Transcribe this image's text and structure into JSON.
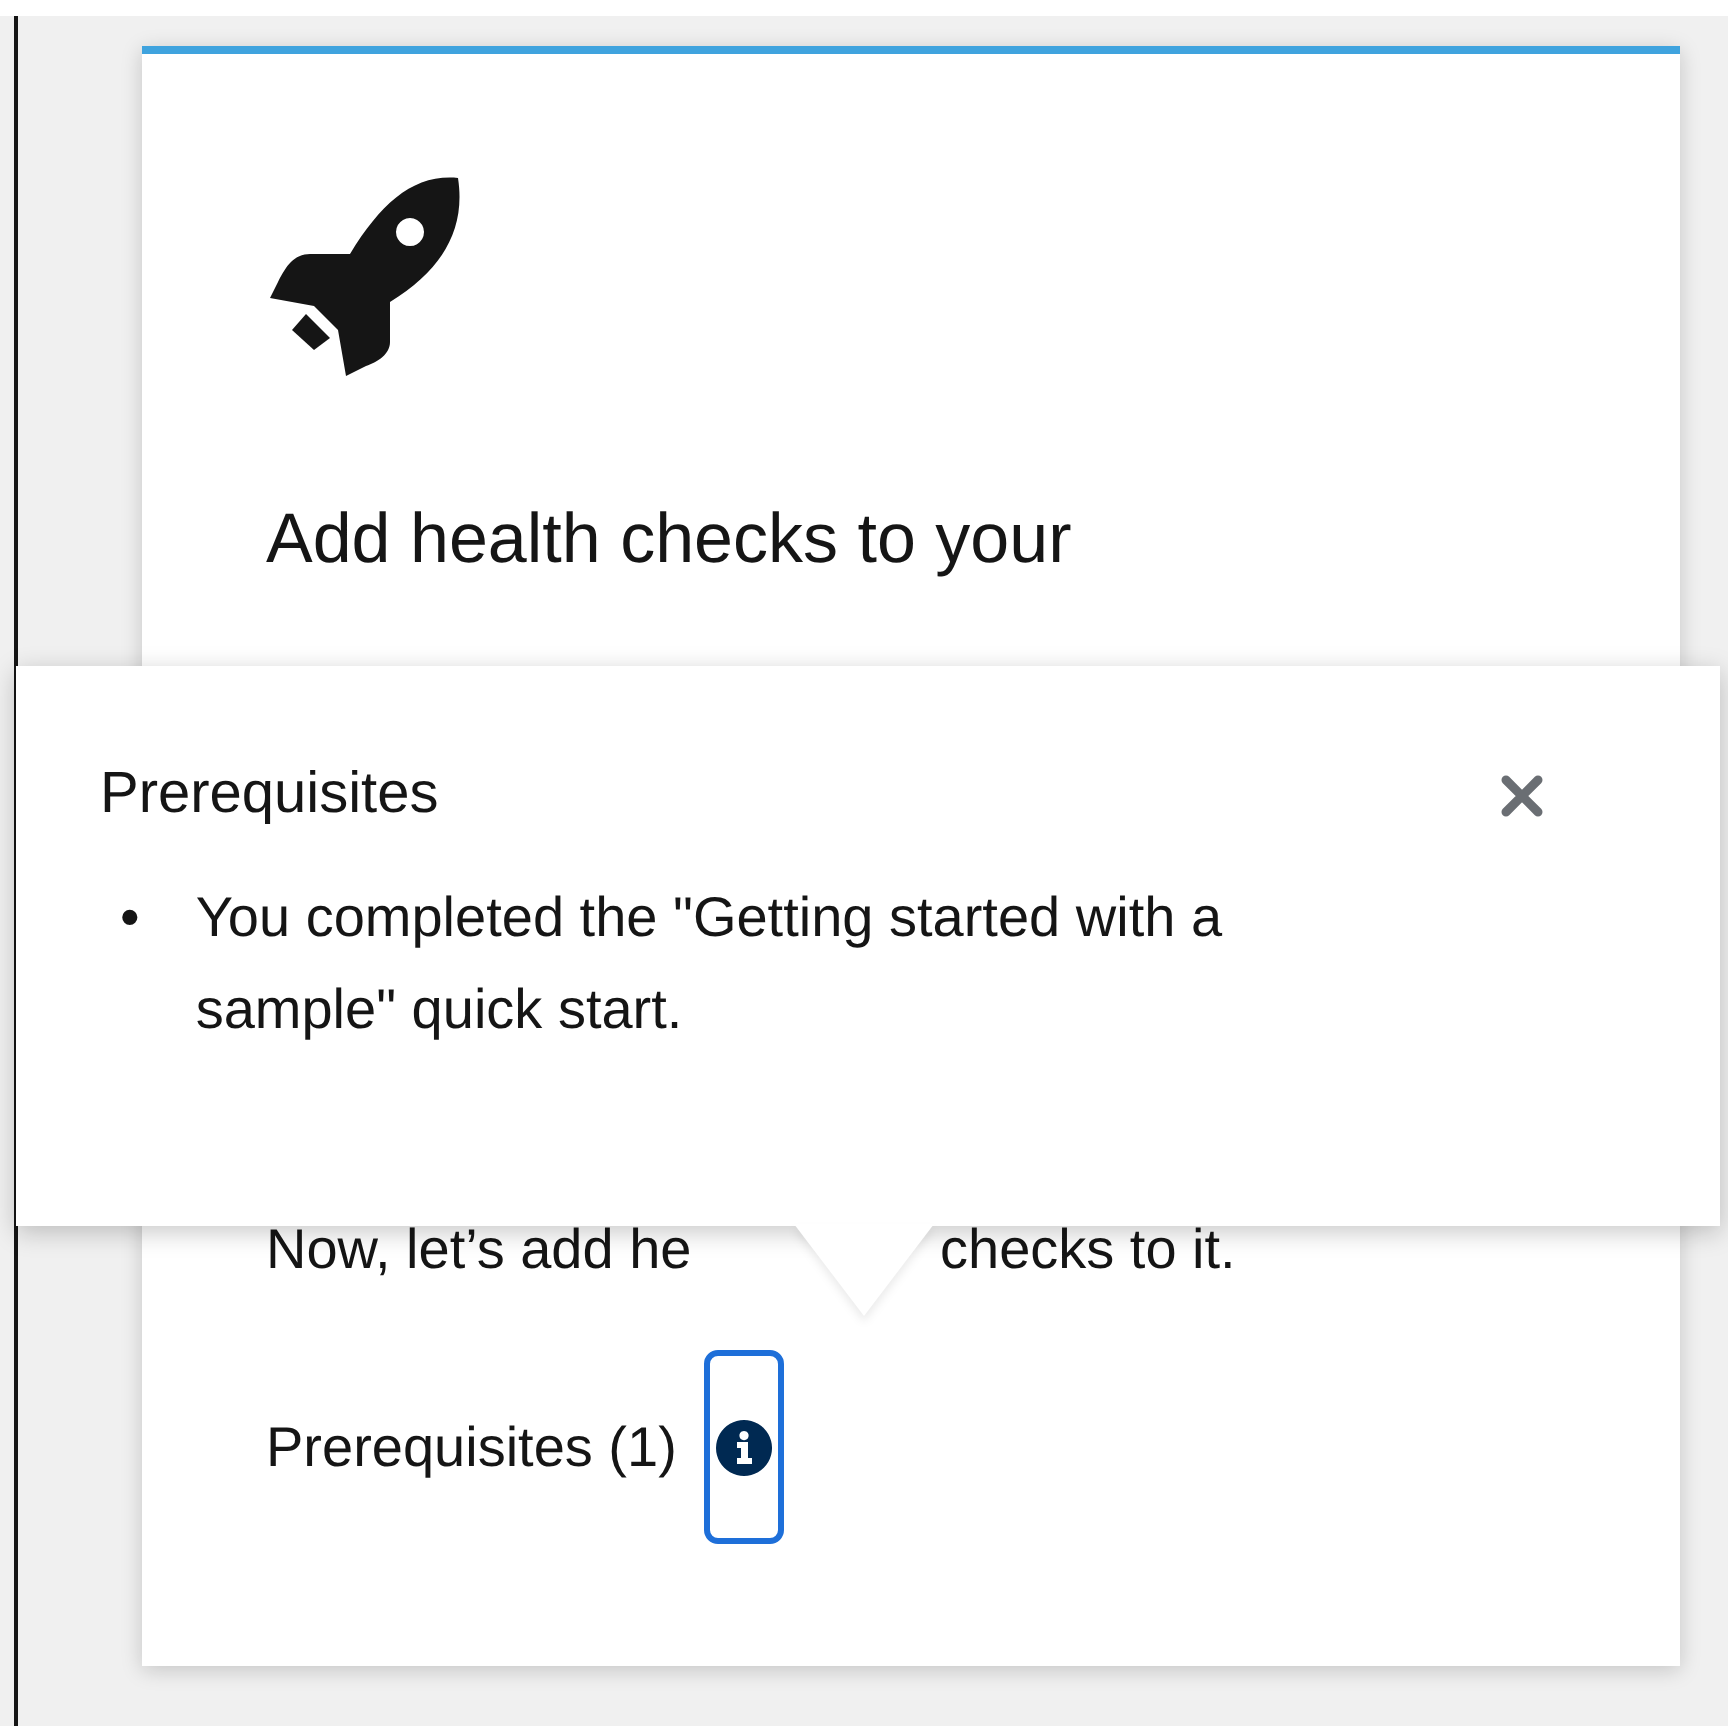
{
  "card": {
    "title": "Add health checks to your",
    "description_parts": [
      "Now, let’s add he",
      "checks to it."
    ],
    "prerequisites_label": "Prerequisites (1)"
  },
  "popover": {
    "title": "Prerequisites",
    "items": [
      {
        "marker": "•",
        "text": "You completed the \"Getting started with a sample\" quick start."
      }
    ]
  }
}
